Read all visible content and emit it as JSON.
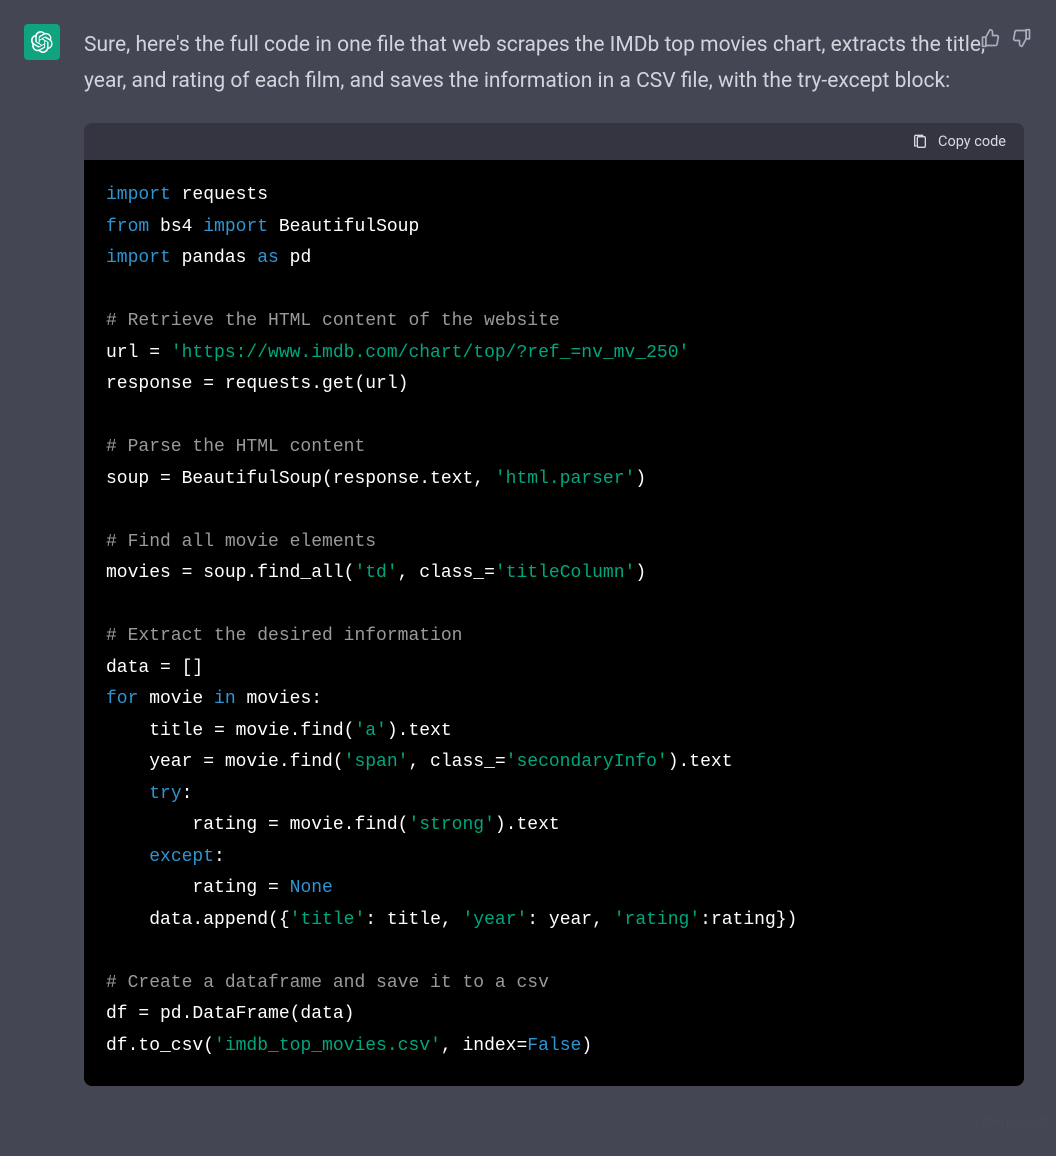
{
  "message": {
    "intro": "Sure, here's the full code in one file that web scrapes the IMDb top movies chart, extracts the title, year, and rating of each film, and saves the information in a CSV file, with the try-except block:"
  },
  "code_header": {
    "copy_label": "Copy code"
  },
  "code": {
    "lines": [
      [
        {
          "c": "kw",
          "t": "import"
        },
        {
          "c": "tk",
          "t": " requests"
        }
      ],
      [
        {
          "c": "kw",
          "t": "from"
        },
        {
          "c": "tk",
          "t": " bs4 "
        },
        {
          "c": "kw",
          "t": "import"
        },
        {
          "c": "tk",
          "t": " BeautifulSoup"
        }
      ],
      [
        {
          "c": "kw",
          "t": "import"
        },
        {
          "c": "tk",
          "t": " pandas "
        },
        {
          "c": "kw",
          "t": "as"
        },
        {
          "c": "tk",
          "t": " pd"
        }
      ],
      [],
      [
        {
          "c": "cm",
          "t": "# Retrieve the HTML content of the website"
        }
      ],
      [
        {
          "c": "tk",
          "t": "url = "
        },
        {
          "c": "st",
          "t": "'https://www.imdb.com/chart/top/?ref_=nv_mv_250'"
        }
      ],
      [
        {
          "c": "tk",
          "t": "response = requests.get(url)"
        }
      ],
      [],
      [
        {
          "c": "cm",
          "t": "# Parse the HTML content"
        }
      ],
      [
        {
          "c": "tk",
          "t": "soup = BeautifulSoup(response.text, "
        },
        {
          "c": "st",
          "t": "'html.parser'"
        },
        {
          "c": "tk",
          "t": ")"
        }
      ],
      [],
      [
        {
          "c": "cm",
          "t": "# Find all movie elements"
        }
      ],
      [
        {
          "c": "tk",
          "t": "movies = soup.find_all("
        },
        {
          "c": "st",
          "t": "'td'"
        },
        {
          "c": "tk",
          "t": ", class_="
        },
        {
          "c": "st",
          "t": "'titleColumn'"
        },
        {
          "c": "tk",
          "t": ")"
        }
      ],
      [],
      [
        {
          "c": "cm",
          "t": "# Extract the desired information"
        }
      ],
      [
        {
          "c": "tk",
          "t": "data = []"
        }
      ],
      [
        {
          "c": "kw",
          "t": "for"
        },
        {
          "c": "tk",
          "t": " movie "
        },
        {
          "c": "kw",
          "t": "in"
        },
        {
          "c": "tk",
          "t": " movies:"
        }
      ],
      [
        {
          "c": "tk",
          "t": "    title = movie.find("
        },
        {
          "c": "st",
          "t": "'a'"
        },
        {
          "c": "tk",
          "t": ").text"
        }
      ],
      [
        {
          "c": "tk",
          "t": "    year = movie.find("
        },
        {
          "c": "st",
          "t": "'span'"
        },
        {
          "c": "tk",
          "t": ", class_="
        },
        {
          "c": "st",
          "t": "'secondaryInfo'"
        },
        {
          "c": "tk",
          "t": ").text"
        }
      ],
      [
        {
          "c": "tk",
          "t": "    "
        },
        {
          "c": "kw",
          "t": "try"
        },
        {
          "c": "tk",
          "t": ":"
        }
      ],
      [
        {
          "c": "tk",
          "t": "        rating = movie.find("
        },
        {
          "c": "st",
          "t": "'strong'"
        },
        {
          "c": "tk",
          "t": ").text"
        }
      ],
      [
        {
          "c": "tk",
          "t": "    "
        },
        {
          "c": "kw",
          "t": "except"
        },
        {
          "c": "tk",
          "t": ":"
        }
      ],
      [
        {
          "c": "tk",
          "t": "        rating = "
        },
        {
          "c": "lit",
          "t": "None"
        }
      ],
      [
        {
          "c": "tk",
          "t": "    data.append({"
        },
        {
          "c": "st",
          "t": "'title'"
        },
        {
          "c": "tk",
          "t": ": title, "
        },
        {
          "c": "st",
          "t": "'year'"
        },
        {
          "c": "tk",
          "t": ": year, "
        },
        {
          "c": "st",
          "t": "'rating'"
        },
        {
          "c": "tk",
          "t": ":rating})"
        }
      ],
      [],
      [
        {
          "c": "cm",
          "t": "# Create a dataframe and save it to a csv"
        }
      ],
      [
        {
          "c": "tk",
          "t": "df = pd.DataFrame(data)"
        }
      ],
      [
        {
          "c": "tk",
          "t": "df.to_csv("
        },
        {
          "c": "st",
          "t": "'imdb_top_movies.csv'"
        },
        {
          "c": "tk",
          "t": ", index="
        },
        {
          "c": "lit",
          "t": "False"
        },
        {
          "c": "tk",
          "t": ")"
        }
      ]
    ]
  },
  "watermark": "CSDN @pxr007"
}
